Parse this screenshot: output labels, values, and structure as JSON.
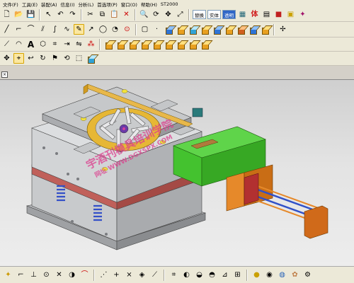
{
  "menu": [
    "文件(F)",
    "工具(E)",
    "装配(A)",
    "信息(I)",
    "分析(L)",
    "首选项(P)",
    "窗口(O)",
    "帮助(H)",
    "ST2000"
  ],
  "toolbar_row1_text_buttons": [
    "替换",
    "实体",
    "透明"
  ],
  "toolbar_row1_extra": "体",
  "doc_tab_label": "×",
  "watermark_line1": "宇酒刊模具培训学院",
  "watermark_line2": "网址 WWW.DGXSPX.COM",
  "colors": {
    "menubar": "#ece9d8",
    "viewport_top": "#cfcfcf",
    "viewport_bottom": "#ededed",
    "mold_plate": "#cfd1d3",
    "red_plate": "#c0605a",
    "green_slide": "#44c22f",
    "orange_cylinder": "#e6892a",
    "yellow_rail": "#e8b84a",
    "blue_spring": "#3350c8"
  }
}
